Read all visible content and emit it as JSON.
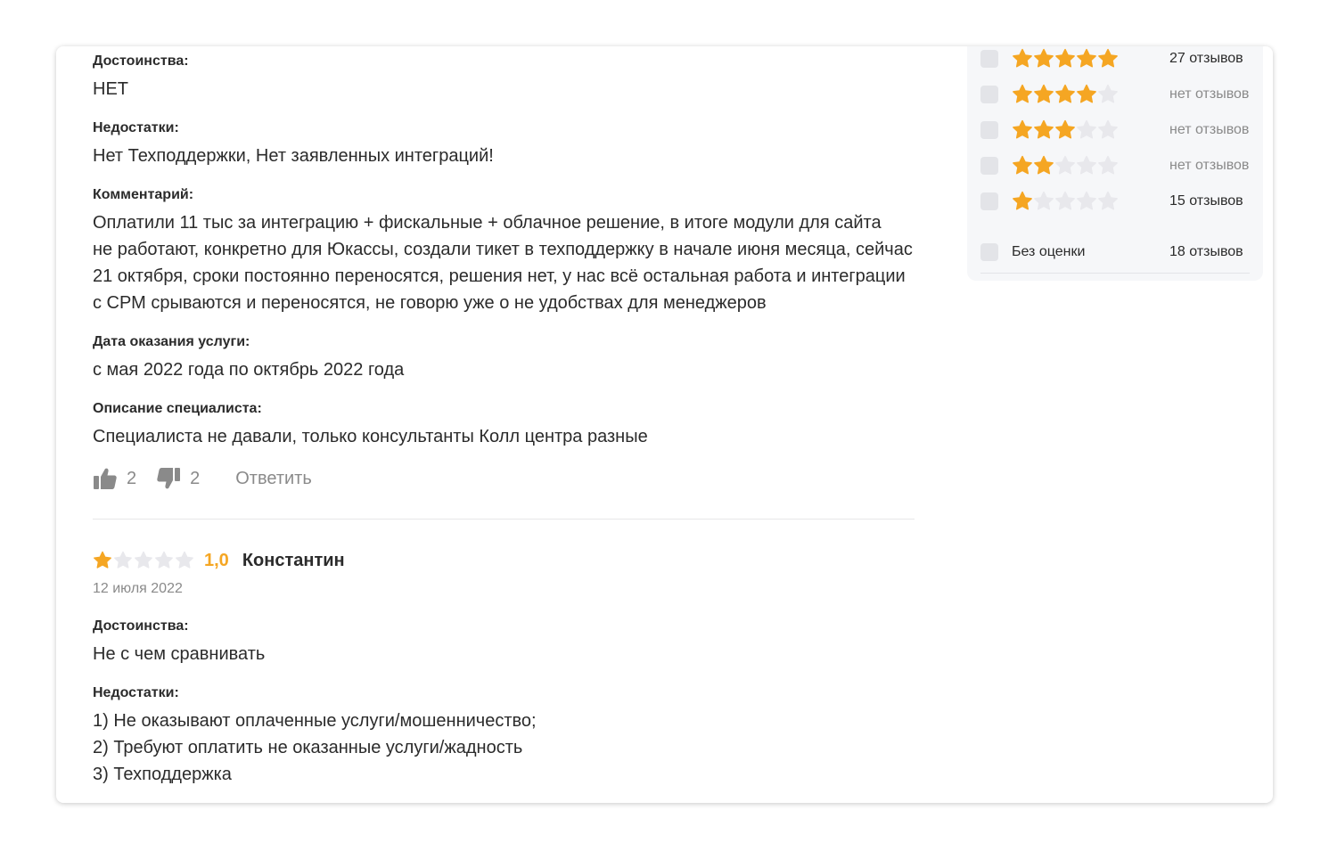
{
  "colors": {
    "star_filled": "#f5a623",
    "star_empty": "#e8e8ec",
    "muted_text": "#8a8a8a",
    "primary_text": "#2b2b2b"
  },
  "review1": {
    "pros_label": "Достоинства:",
    "pros_text": "НЕТ",
    "cons_label": "Недостатки:",
    "cons_text": "Нет Техподдержки, Нет заявленных интеграций!",
    "comment_label": "Комментарий:",
    "comment_lines": [
      "Оплатили 11 тыс за интеграцию + фискальные + облачное решение, в итоге модули для сайта",
      "не работают, конкретно для Юкассы, создали тикет в техподдержку в начале июня месяца, сейчас",
      "21 октября, сроки постоянно переносятся, решения нет, у нас всё остальная работа и интеграции",
      "с СРМ срываются и переносятся, не говорю уже о не удобствах для менеджеров"
    ],
    "service_date_label": "Дата оказания услуги:",
    "service_date_text": "с мая 2022 года по октябрь 2022 года",
    "specialist_label": "Описание специалиста:",
    "specialist_text": "Специалиста не давали, только консультанты Колл центра разные",
    "likes": "2",
    "dislikes": "2",
    "reply_label": "Ответить"
  },
  "review2": {
    "rating": 1,
    "score_text": "1,0",
    "author": "Константин",
    "date": "12 июля 2022",
    "pros_label": "Достоинства:",
    "pros_text": "Не с чем сравнивать",
    "cons_label": "Недостатки:",
    "cons_lines": [
      "1) Не оказывают оплаченные услуги/мошенничество;",
      "2) Требуют оплатить не оказанные услуги/жадность",
      "3) Техподдержка"
    ]
  },
  "rating_filter": {
    "rows": [
      {
        "stars": 5,
        "count": "27 отзывов",
        "has_reviews": true
      },
      {
        "stars": 4,
        "count": "нет отзывов",
        "has_reviews": false
      },
      {
        "stars": 3,
        "count": "нет отзывов",
        "has_reviews": false
      },
      {
        "stars": 2,
        "count": "нет отзывов",
        "has_reviews": false
      },
      {
        "stars": 1,
        "count": "15 отзывов",
        "has_reviews": true
      }
    ],
    "no_rating_label": "Без оценки",
    "no_rating_count": "18 отзывов"
  }
}
